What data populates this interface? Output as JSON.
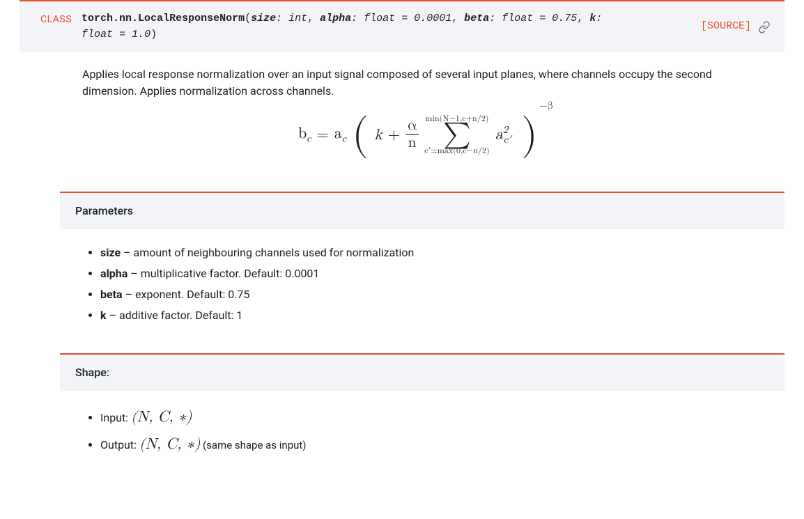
{
  "signature": {
    "class_tag": "CLASS",
    "qualname": "torch.nn.LocalResponseNorm",
    "params": [
      {
        "name": "size",
        "type": "int",
        "default": null
      },
      {
        "name": "alpha",
        "type": "float",
        "default": "0.0001"
      },
      {
        "name": "beta",
        "type": "float",
        "default": "0.75"
      },
      {
        "name": "k",
        "type": "float",
        "default": "1.0"
      }
    ],
    "source_label": "[SOURCE]"
  },
  "description": "Applies local response normalization over an input signal composed of several input planes, where channels occupy the second dimension. Applies normalization across channels.",
  "formula": {
    "lhs_base": "b",
    "lhs_sub": "c",
    "rhs_base": "a",
    "rhs_sub": "c",
    "k": "k",
    "frac_num": "α",
    "frac_den": "n",
    "sum_upper": "min(N−1,c+n/2)",
    "sum_lower": "c′=max(0,c−n/2)",
    "term_base": "a",
    "term_sub": "c′",
    "term_sup": "2",
    "outer_exp": "−β"
  },
  "parameters": {
    "title": "Parameters",
    "items": [
      {
        "name": "size",
        "text": " – amount of neighbouring channels used for normalization"
      },
      {
        "name": "alpha",
        "text": " – multiplicative factor. Default: 0.0001"
      },
      {
        "name": "beta",
        "text": " – exponent. Default: 0.75"
      },
      {
        "name": "k",
        "text": " – additive factor. Default: 1"
      }
    ]
  },
  "shape": {
    "title": "Shape:",
    "items": [
      {
        "label": "Input: ",
        "math": "(N, C, ∗)",
        "note": ""
      },
      {
        "label": "Output: ",
        "math": "(N, C, ∗)",
        "note": " (same shape as input)"
      }
    ]
  }
}
